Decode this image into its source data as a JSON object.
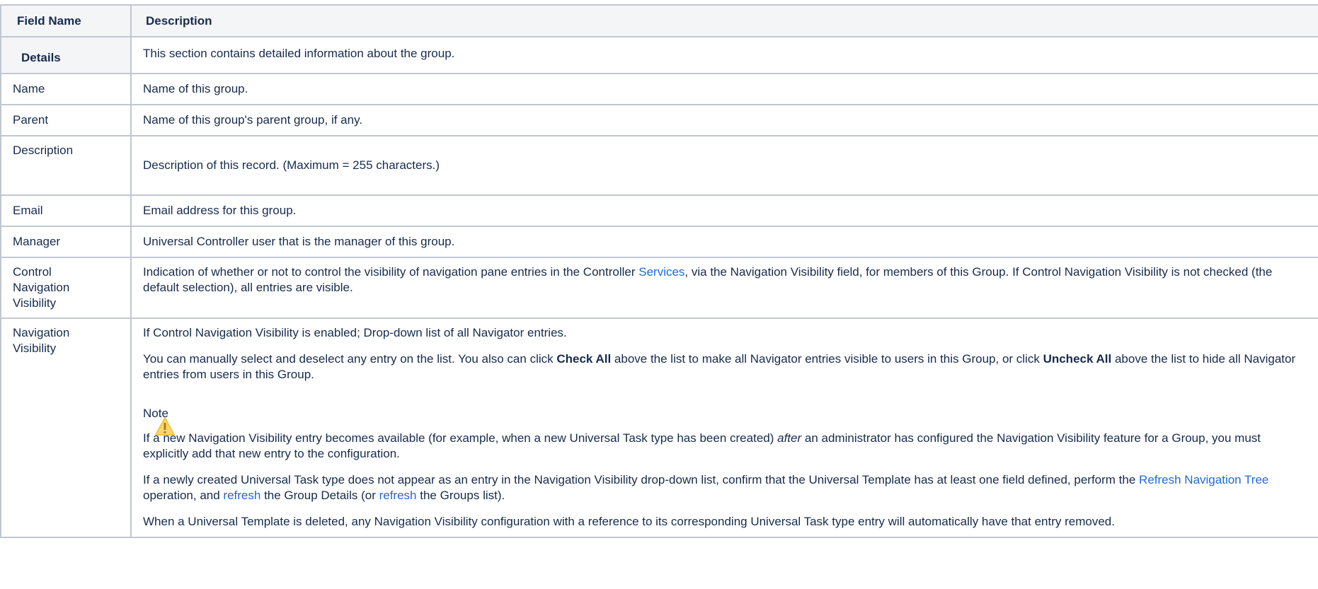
{
  "header": {
    "col1": "Field Name",
    "col2": "Description"
  },
  "section": {
    "label": "Details",
    "text": "This section contains detailed information about the group."
  },
  "rows": {
    "name": {
      "field": "Name",
      "desc": "Name of this group."
    },
    "parent": {
      "field": "Parent",
      "desc": "Name of this group's parent group, if any."
    },
    "description": {
      "field": "Description",
      "desc": "Description of this record. (Maximum = 255 characters.)"
    },
    "email": {
      "field": "Email",
      "desc": "Email address for this group."
    },
    "manager": {
      "field": "Manager",
      "desc": "Universal Controller user that is the manager of this group."
    },
    "control_nav": {
      "field_line1": "Control",
      "field_line2": "Navigation",
      "field_line3": "Visibility",
      "desc_before_link": "Indication of whether or not to control the visibility of navigation pane entries in the Controller ",
      "link": "Services",
      "desc_after_link": ", via the Navigation Visibility field, for members of this Group. If Control Navigation Visibility is not checked (the default selection), all entries are visible."
    },
    "nav_visibility": {
      "field_line1": "Navigation",
      "field_line2": "Visibility",
      "p1": "If Control Navigation Visibility is enabled; Drop-down list of all Navigator entries.",
      "p2_a": "You can manually select and deselect any entry on the list. You also can click ",
      "p2_b": "Check All",
      "p2_c": " above the list to make all Navigator entries visible to users in this Group, or click ",
      "p2_d": "Uncheck All",
      "p2_e": " above the list to hide all Navigator entries from users in this Group.",
      "note_title": "Note",
      "note_icon": "warning-icon",
      "note_a": "If a new Navigation Visibility entry becomes available (for example, when a new Universal Task type has been created) ",
      "note_b": "after",
      "note_c": " an administrator has configured the Navigation Visibility feature for a Group, you must explicitly add that new entry to the configuration.",
      "p3_a": "If a newly created Universal Task type does not appear as an entry in the Navigation Visibility drop-down list, confirm that the Universal Template has at least one field defined, perform the ",
      "p3_link1": "Refresh Navigation Tree",
      "p3_b": " operation, and ",
      "p3_link2": "refresh",
      "p3_c": " the Group Details (or ",
      "p3_link3": "refresh",
      "p3_d": " the Groups list).",
      "p4": "When a Universal Template is deleted, any Navigation Visibility configuration with a reference to its corresponding Universal Task type entry will automatically have that entry removed."
    }
  },
  "colors": {
    "link": "#1f6bd6",
    "border": "#c1c7d0",
    "header_bg": "#f4f5f7",
    "warning": "#f2c744"
  }
}
